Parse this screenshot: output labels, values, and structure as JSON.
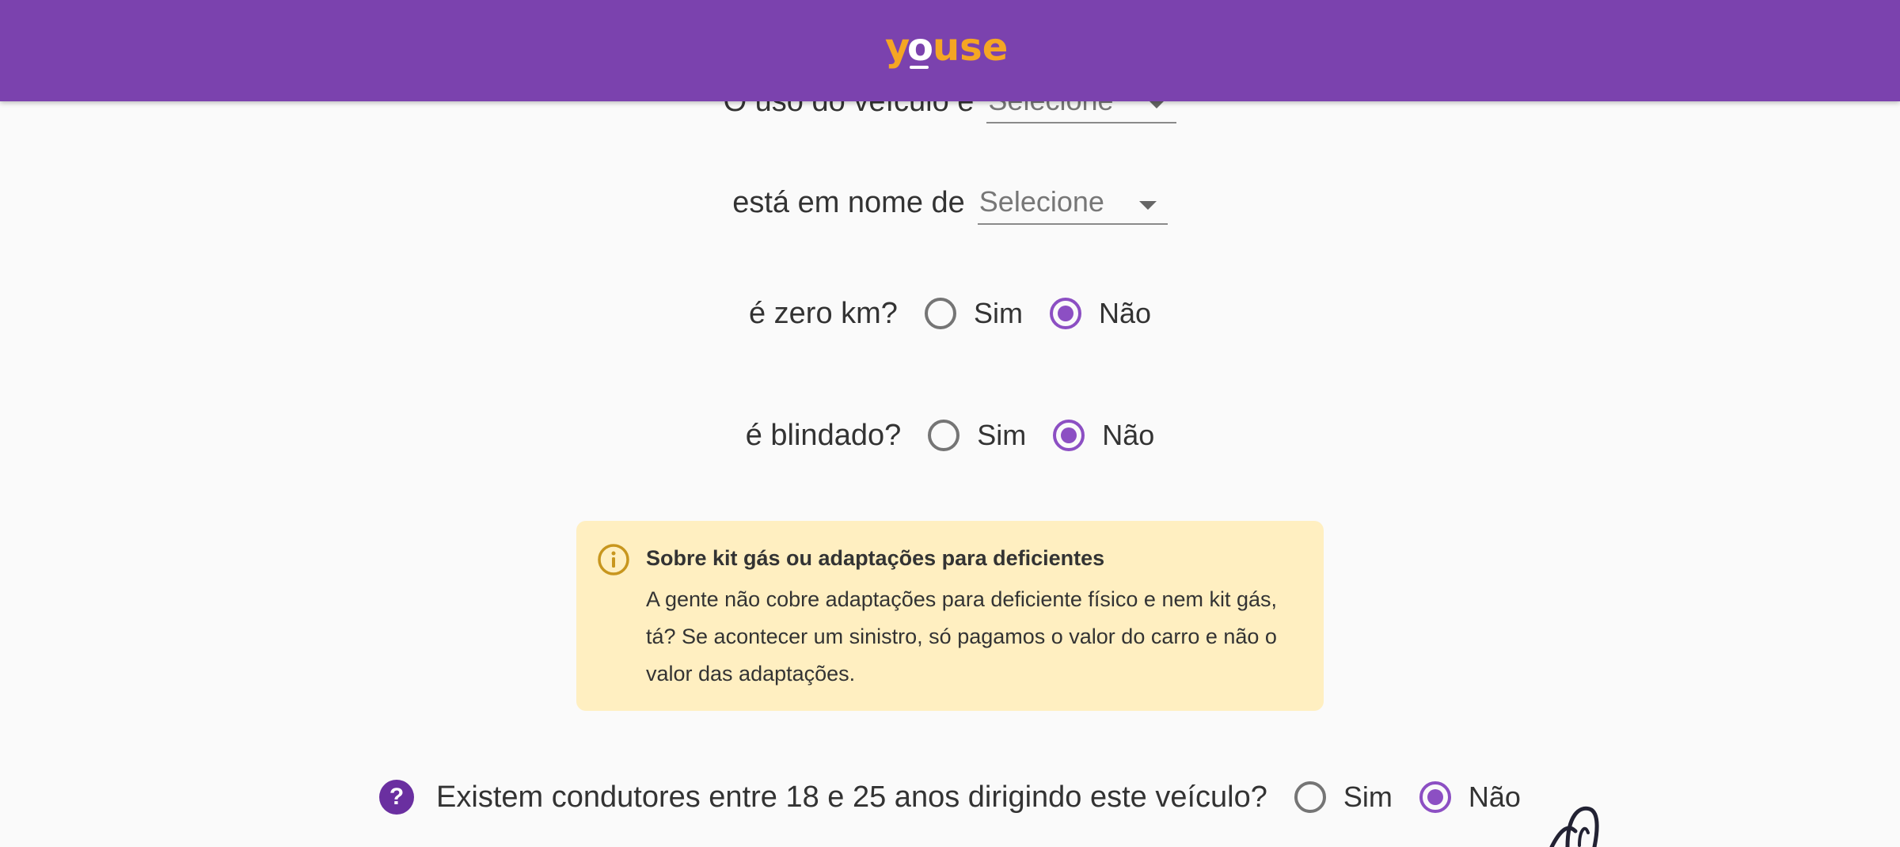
{
  "header": {
    "logo_text": "youse",
    "background_color": "#7b42ae",
    "logo_color": "#f5a623"
  },
  "form": {
    "vehicle_use": {
      "label": "O uso do veículo é",
      "value": "Selecione"
    },
    "owner_name": {
      "label": "está em nome de",
      "value": "Selecione"
    },
    "zero_km": {
      "label": "é zero km?",
      "options": [
        {
          "label": "Sim",
          "checked": false
        },
        {
          "label": "Não",
          "checked": true
        }
      ]
    },
    "armored": {
      "label": "é blindado?",
      "options": [
        {
          "label": "Sim",
          "checked": false
        },
        {
          "label": "Não",
          "checked": true
        }
      ]
    },
    "young_drivers": {
      "label": "Existem condutores entre 18 e 25 anos dirigindo este veículo?",
      "help_icon": "?",
      "options": [
        {
          "label": "Sim",
          "checked": false
        },
        {
          "label": "Não",
          "checked": true
        }
      ]
    }
  },
  "notice": {
    "icon": "info-icon",
    "title": "Sobre kit gás ou adaptações para deficientes",
    "body": "A gente não cobre adaptações para deficiente físico e nem kit gás, tá? Se acontecer um sinistro, só pagamos o valor do carro e não o valor das adaptações.",
    "background_color": "#ffefc1",
    "icon_color": "#c8961e"
  },
  "colors": {
    "accent": "#8c4fc3",
    "text": "#333333"
  }
}
